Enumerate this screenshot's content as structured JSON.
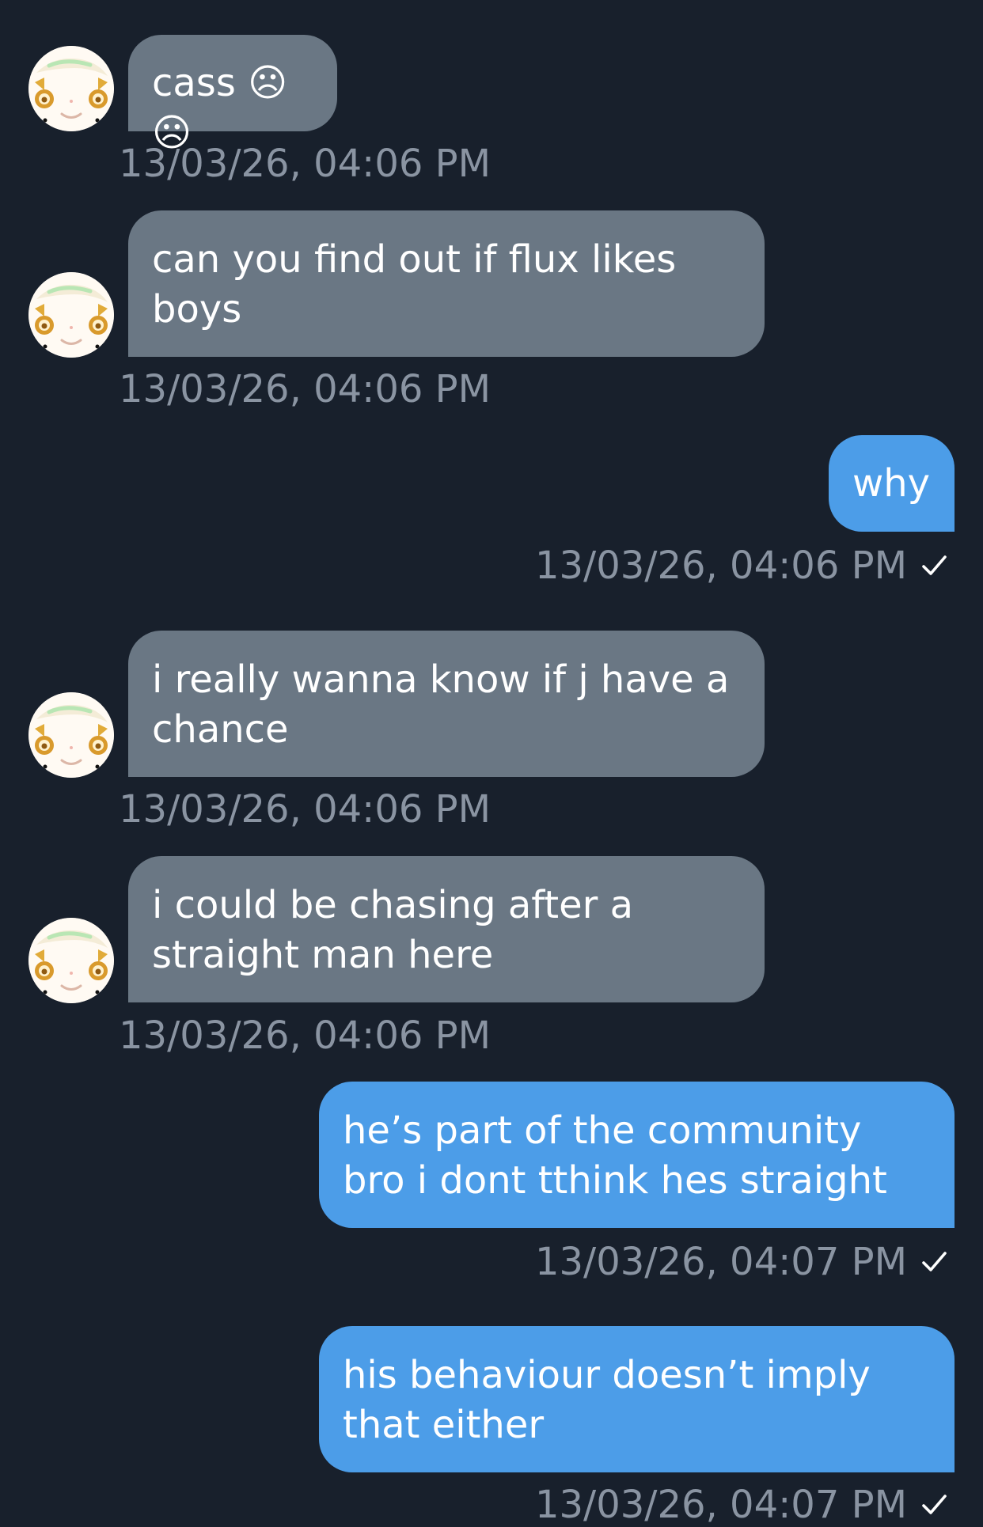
{
  "messages": [
    {
      "direction": "incoming",
      "text": "cass ☹☹",
      "timestamp": "13/03/26, 04:06 PM"
    },
    {
      "direction": "incoming",
      "text": "can you find out if flux likes boys",
      "timestamp": "13/03/26, 04:06 PM"
    },
    {
      "direction": "outgoing",
      "text": "why",
      "timestamp": "13/03/26, 04:06 PM",
      "status": "sent"
    },
    {
      "direction": "incoming",
      "text": "i really wanna know if j have a chance",
      "timestamp": "13/03/26, 04:06 PM"
    },
    {
      "direction": "incoming",
      "text": "i could be chasing after a straight man here",
      "timestamp": "13/03/26, 04:06 PM"
    },
    {
      "direction": "outgoing",
      "text": "he’s part of the community bro i dont tthink hes straight",
      "timestamp": "13/03/26, 04:07 PM",
      "status": "sent"
    },
    {
      "direction": "outgoing",
      "text": "his behaviour doesn’t imply that either",
      "timestamp": "13/03/26, 04:07 PM",
      "status": "sent"
    }
  ],
  "colors": {
    "background": "#18202c",
    "incoming_bubble": "#6a7784",
    "outgoing_bubble": "#4c9de8",
    "timestamp": "#8a94a2",
    "text": "#ffffff"
  },
  "icons": {
    "sent_status": "checkmark-icon",
    "contact_avatar": "anime-avatar-icon"
  }
}
